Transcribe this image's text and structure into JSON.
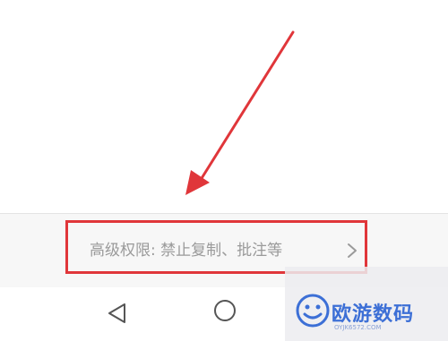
{
  "settings_row": {
    "label": "高级权限: 禁止复制、批注等"
  },
  "icons": {
    "row_chevron": "chevron-right-icon",
    "nav_back": "back-triangle-icon",
    "nav_home": "home-circle-icon",
    "watermark_logo": "smiley-logo-icon"
  },
  "annotation": {
    "color": "#e0363a"
  },
  "watermark": {
    "brand": "欧游数码",
    "url": "OYJK6572.COM"
  }
}
